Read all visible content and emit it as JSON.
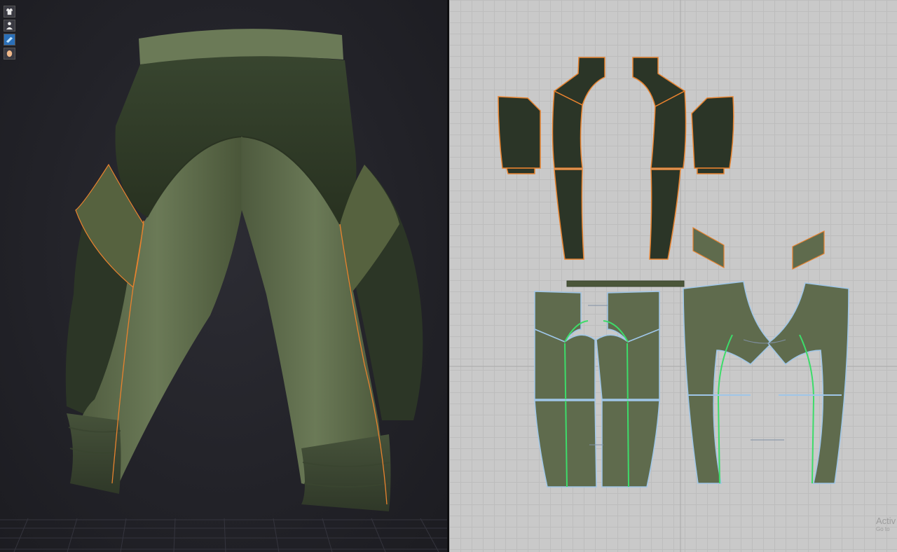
{
  "toolbar": {
    "items": [
      {
        "icon": "shirt-icon"
      },
      {
        "icon": "avatar-icon"
      },
      {
        "icon": "fabric-icon"
      },
      {
        "icon": "face-icon"
      }
    ]
  },
  "watermark": {
    "title": "Activ",
    "subtitle": "Go to"
  },
  "colors": {
    "fabric_light": "#5f6b4d",
    "fabric_dark": "#2b3527",
    "seam_orange": "#e8822e",
    "seam_green": "#3ddc6a",
    "seam_blue": "#9fc6e8",
    "board": "#c9c9c9",
    "viewport": "#222228"
  }
}
